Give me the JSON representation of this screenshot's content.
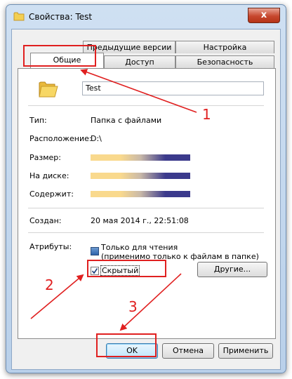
{
  "window": {
    "title": "Свойства: Test",
    "close_glyph": "x"
  },
  "tabs": {
    "row1": [
      {
        "label": "Предыдущие версии"
      },
      {
        "label": "Настройка"
      }
    ],
    "row2": [
      {
        "label": "Общие"
      },
      {
        "label": "Доступ"
      },
      {
        "label": "Безопасность"
      }
    ]
  },
  "general": {
    "name": "Test",
    "type_label": "Тип:",
    "type_value": "Папка с файлами",
    "location_label": "Расположение:",
    "location_value": "D:\\",
    "size_label": "Размер:",
    "ondisk_label": "На диске:",
    "contains_label": "Содержит:",
    "created_label": "Создан:",
    "created_value": "20 мая 2014 г., 22:51:08",
    "attributes_label": "Атрибуты:",
    "readonly_label_line1": "Только для чтения",
    "readonly_label_line2": "(применимо только к файлам в папке)",
    "hidden_label": "Скрытый",
    "other_button": "Другие...",
    "hidden_checked": true
  },
  "buttons": {
    "ok": "OK",
    "cancel": "Отмена",
    "apply": "Применить"
  },
  "annotations": {
    "n1": "1",
    "n2": "2",
    "n3": "3"
  },
  "colors": {
    "annotation": "#e02020",
    "folder": "#f3cf52",
    "blur_start": "#f9d98d",
    "blur_end": "#3b3a8c"
  }
}
